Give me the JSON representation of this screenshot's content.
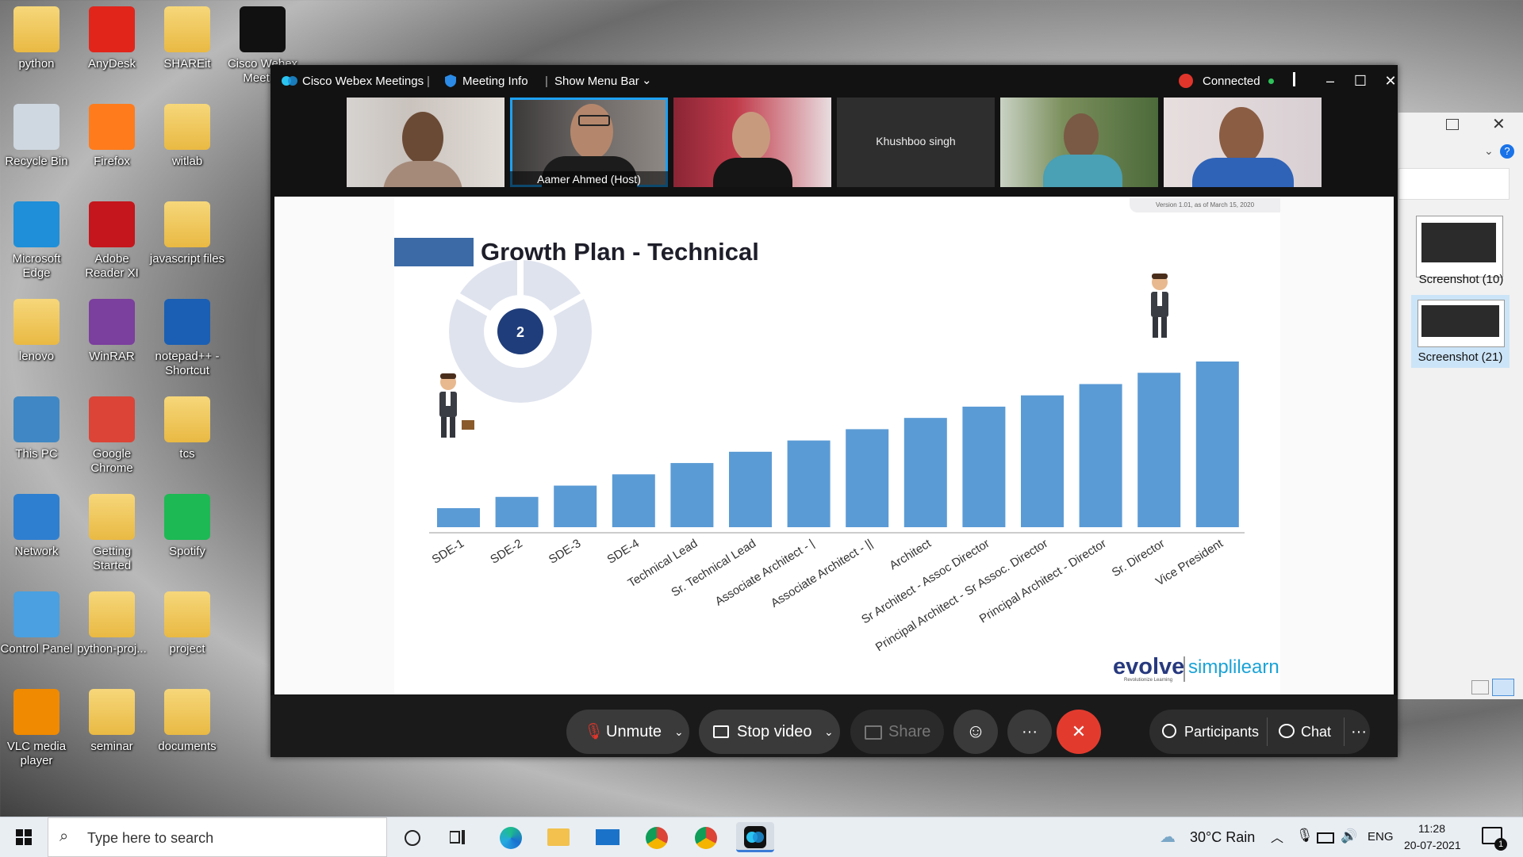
{
  "desktop": {
    "icons": [
      {
        "label": "python"
      },
      {
        "label": "AnyDesk"
      },
      {
        "label": "SHAREit"
      },
      {
        "label": "Cisco Webex Meeti..."
      },
      {
        "label": "Recycle Bin"
      },
      {
        "label": "Firefox"
      },
      {
        "label": "witlab"
      },
      {
        "label": "Microsoft Edge"
      },
      {
        "label": "Adobe Reader XI"
      },
      {
        "label": "javascript files"
      },
      {
        "label": "lenovo"
      },
      {
        "label": "WinRAR"
      },
      {
        "label": "notepad++ - Shortcut"
      },
      {
        "label": "This PC"
      },
      {
        "label": "Google Chrome"
      },
      {
        "label": "tcs"
      },
      {
        "label": "Network"
      },
      {
        "label": "Getting Started"
      },
      {
        "label": "Spotify"
      },
      {
        "label": "Control Panel"
      },
      {
        "label": "python-proj..."
      },
      {
        "label": "project"
      },
      {
        "label": "VLC media player"
      },
      {
        "label": "seminar"
      },
      {
        "label": "documents"
      }
    ]
  },
  "webex": {
    "app_title": "Cisco Webex Meetings",
    "meeting_info": "Meeting Info",
    "show_menu_bar": "Show Menu Bar",
    "status": "Connected",
    "participants": [
      {
        "name": ""
      },
      {
        "name": "Aamer Ahmed  (Host)"
      },
      {
        "name": ""
      },
      {
        "name": "Khushboo singh"
      },
      {
        "name": ""
      },
      {
        "name": ""
      }
    ],
    "toolbar": {
      "unmute": "Unmute",
      "stop_video": "Stop video",
      "share": "Share",
      "participants": "Participants",
      "chat": "Chat"
    }
  },
  "slide": {
    "version": "Version 1.01, as of March 15, 2020",
    "title": "Growth Plan - Technical",
    "badge_number": "2",
    "logo_evolve": "evolve",
    "logo_evolve_sub": "Revolutionize Learning",
    "logo_simplilearn": "simplilearn"
  },
  "chart_data": {
    "type": "bar",
    "title": "Growth Plan - Technical",
    "categories": [
      "SDE-1",
      "SDE-2",
      "SDE-3",
      "SDE-4",
      "Technical Lead",
      "Sr. Technical Lead",
      "Associate Architect - |",
      "Associate Architect - ||",
      "Architect",
      "Sr Architect - Assoc Director",
      "Principal Architect - Sr Assoc. Director",
      "Principal Architect - Director",
      "Sr. Director",
      "Vice President"
    ],
    "values": [
      1,
      2,
      3,
      4,
      5,
      6,
      7,
      8,
      9,
      10,
      11,
      12,
      13,
      14
    ],
    "ylim": [
      0,
      15
    ],
    "grid": false,
    "legend": "none",
    "color": "#5b9bd5"
  },
  "side_panel": {
    "items": [
      {
        "label": "Screenshot (10)"
      },
      {
        "label": "Screenshot (21)"
      }
    ]
  },
  "taskbar": {
    "search_placeholder": "Type here to search",
    "weather": "30°C  Rain",
    "language": "ENG",
    "time": "11:28",
    "date": "20-07-2021",
    "notifications": "1"
  }
}
